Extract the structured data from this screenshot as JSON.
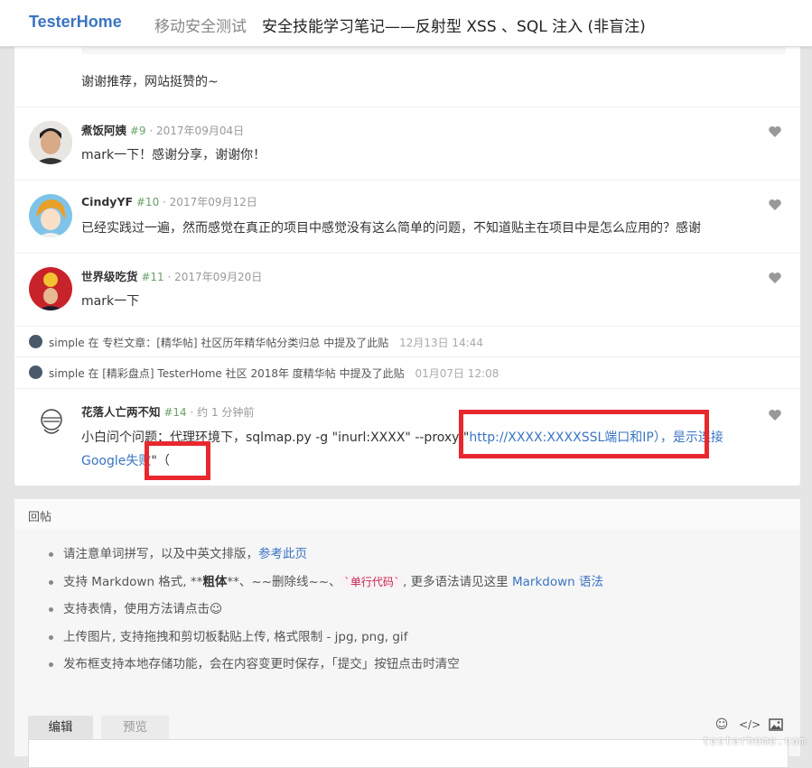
{
  "navbar": {
    "brand": "TesterHome",
    "section": "移动安全测试",
    "title": "安全技能学习笔记——反射型 XSS 、SQL 注入 (非盲注)"
  },
  "replies": [
    {
      "text": "谢谢推荐，网站挺赞的~"
    },
    {
      "author": "煮饭阿姨",
      "floor": "#9",
      "time": "2017年09月04日",
      "text": "mark一下！感谢分享，谢谢你！"
    },
    {
      "author": "CindyYF",
      "floor": "#10",
      "time": "2017年09月12日",
      "text": "已经实践过一遍，然而感觉在真正的项目中感觉没有这么简单的问题，不知道贴主在项目中是怎么应用的？感谢"
    },
    {
      "author": "世界级吃货",
      "floor": "#11",
      "time": "2017年09月20日",
      "text": "mark一下"
    },
    {
      "author": "花落人亡两不知",
      "floor": "#14",
      "time": "约 1 分钟前",
      "text_line1_plain": "小白问个问题：代理环境下，sqlmap.py -g \"inurl:XXXX\" --proxy \"",
      "text_line1_link": "http://XXXX:XXXXSSL端口和IP），是示连接",
      "text_line2_link": "Google失败",
      "text_line2_plain": "\"（"
    }
  ],
  "mentions": [
    {
      "user": "simple",
      "text": "在 专栏文章：[精华帖] 社区历年精华帖分类归总 中提及了此贴",
      "time": "12月13日 14:44"
    },
    {
      "user": "simple",
      "text": "在 [精彩盘点] TesterHome 社区 2018年 度精华帖 中提及了此贴",
      "time": "01月07日 12:08"
    }
  ],
  "reply_form": {
    "title": "回帖",
    "tips": {
      "t1_a": "请注意单词拼写，以及中英文排版，",
      "t1_link": "参考此页",
      "t2_a": "支持 Markdown 格式, **",
      "t2_bold": "粗体",
      "t2_b": "**、~~删除线~~、",
      "t2_code": "`单行代码`",
      "t2_c": ", 更多语法请见这里 ",
      "t2_link": "Markdown 语法",
      "t3": "支持表情，使用方法请点击",
      "t3_icon": "☺",
      "t4": "上传图片, 支持拖拽和剪切板黏贴上传, 格式限制 - jpg, png, gif",
      "t5": "发布框支持本地存储功能，会在内容变更时保存，「提交」按钮点击时清空"
    },
    "tab_edit": "编辑",
    "tab_preview": "预览",
    "tool_emoji": "☺",
    "tool_code": "</>"
  },
  "watermark": "testerhome.com",
  "colors": {
    "brand": "#3a74c2",
    "highlight_box": "#e8282d",
    "floor": "#6b9f6b"
  },
  "icons": [
    "heart-icon",
    "emoji-icon",
    "code-icon",
    "image-icon"
  ]
}
